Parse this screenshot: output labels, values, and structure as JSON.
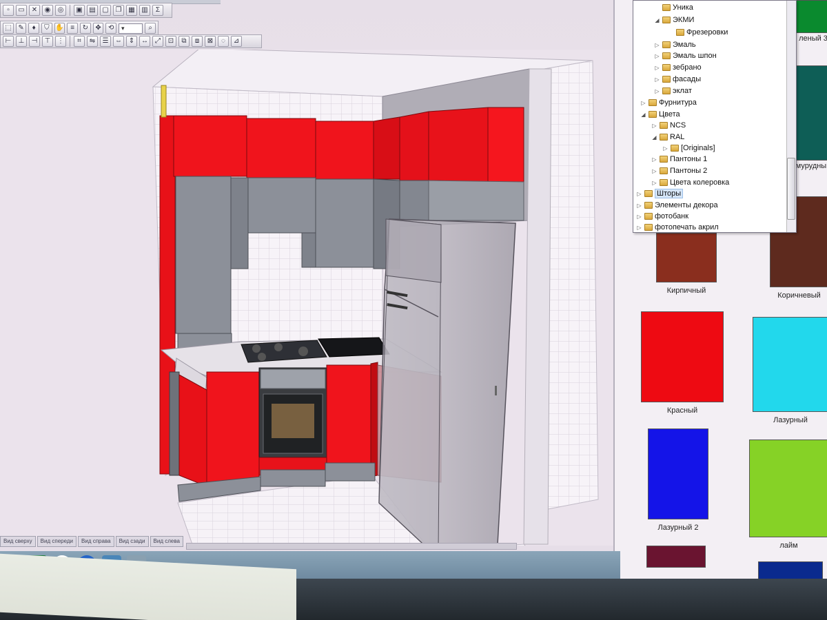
{
  "toolbar": {
    "sigma_label": "Σ"
  },
  "view_tabs": [
    "Вид сверху",
    "Вид спереди",
    "Вид справа",
    "Вид сзади",
    "Вид слева"
  ],
  "tree": {
    "items": [
      {
        "label": "Уника",
        "arrow": ""
      },
      {
        "label": "ЭКМИ",
        "arrow": "◢"
      },
      {
        "label": "Фрезеровки",
        "arrow": ""
      },
      {
        "label": "Эмаль",
        "arrow": "▷"
      },
      {
        "label": "Эмаль шпон",
        "arrow": "▷"
      },
      {
        "label": "зебрано",
        "arrow": "▷"
      },
      {
        "label": "фасады",
        "arrow": "▷"
      },
      {
        "label": "эклат",
        "arrow": "▷"
      },
      {
        "label": "Фурнитура",
        "arrow": "▷"
      },
      {
        "label": "Цвета",
        "arrow": "◢"
      },
      {
        "label": "NCS",
        "arrow": "▷"
      },
      {
        "label": "RAL",
        "arrow": "◢"
      },
      {
        "label": "[Originals]",
        "arrow": "▷"
      },
      {
        "label": "Пантоны 1",
        "arrow": "▷"
      },
      {
        "label": "Пантоны 2",
        "arrow": "▷"
      },
      {
        "label": "Цвета колеровка",
        "arrow": "▷"
      },
      {
        "label": "Шторы",
        "arrow": "▷"
      },
      {
        "label": "Элементы декора",
        "arrow": "▷"
      },
      {
        "label": "фотобанк",
        "arrow": "▷"
      },
      {
        "label": "фотопечать акрил",
        "arrow": "▷"
      }
    ]
  },
  "swatches": [
    {
      "label": "леный 3",
      "color": "#0a8a2e"
    },
    {
      "label": "мурудный",
      "color": "#0e5e56"
    },
    {
      "label": "Кирпичный",
      "color": "#8a2e1e"
    },
    {
      "label": "Коричневый",
      "color": "#5e2a1e"
    },
    {
      "label": "Красный",
      "color": "#ee0a12"
    },
    {
      "label": "Лазурный",
      "color": "#22d8ec"
    },
    {
      "label": "Лазурный 2",
      "color": "#1414e8"
    },
    {
      "label": "лайм",
      "color": "#86d226"
    },
    {
      "label": "",
      "color": "#6a1430"
    },
    {
      "label": "",
      "color": "#0a2a8e"
    }
  ],
  "colors": {
    "cabinet_red": "#f0141c",
    "cabinet_gray": "#8a8e98",
    "fridge_glass": "#b8b4bc",
    "tile": "#f6f2f6"
  }
}
